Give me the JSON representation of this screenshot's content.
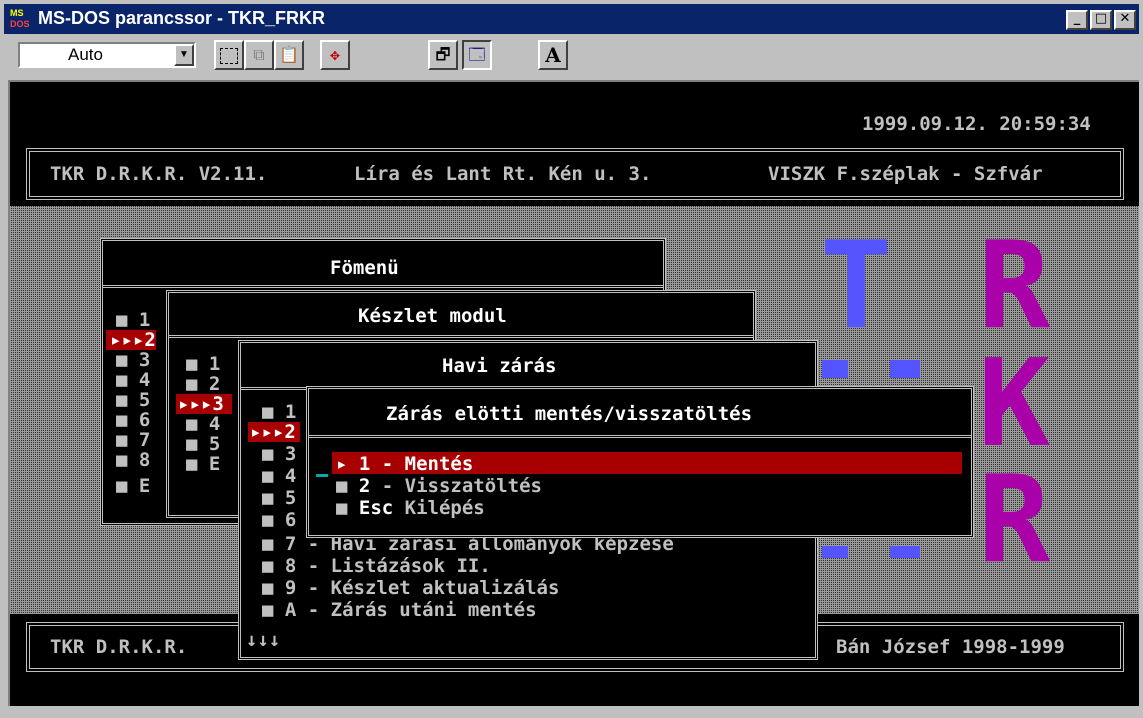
{
  "window": {
    "icon_text_top": "MS",
    "icon_text_bottom": "DOS",
    "title": "MS-DOS parancssor - TKR_FRKR",
    "minimize": "_",
    "maximize": "□",
    "close": "✕"
  },
  "toolbar": {
    "font_size_value": "Auto",
    "buttons": [
      "mark-icon",
      "copy-icon",
      "paste-icon",
      "fullscreen-icon",
      "properties-icon",
      "background-icon",
      "font-icon"
    ],
    "font_button_label": "A"
  },
  "console": {
    "timestamp": "1999.09.12. 20:59:34",
    "header_left": "TKR D.R.K.R. V2.11.",
    "header_mid": "Líra és Lant Rt. Kén u. 3.",
    "header_right": "VISZK F.széplak - Szfvár",
    "footer_left": "TKR D.R.K.R.",
    "footer_right": "Bán József 1998-1999",
    "logo_letters": [
      "T",
      "R",
      "R",
      "K",
      "R"
    ],
    "menus": {
      "fomenu": {
        "title": "Fömenü",
        "items": [
          "■ 1",
          "▸▸▸2",
          "■ 3",
          "■ 4",
          "■ 5",
          "■ 6",
          "■ 7",
          "■ 8",
          "■ E"
        ]
      },
      "keszlet": {
        "title": "Készlet modul",
        "items": [
          "■ 1",
          "■ 2",
          "▸▸▸3",
          "■ 4",
          "■ 5",
          "■ E"
        ]
      },
      "havi": {
        "title": "Havi zárás",
        "items": [
          "■ 1",
          "▸▸▸2",
          "■ 3",
          "■ 4",
          "■ 5",
          "■ 6"
        ],
        "long_items": [
          "■ 7 - Havi zárási állományok képzése",
          "■ 8 - Listázások II.",
          "■ 9 - Készlet aktualizálás",
          "■ A - Zárás utáni mentés"
        ],
        "more": "↓↓↓"
      },
      "mentes": {
        "title": "Zárás elötti mentés/visszatöltés",
        "items": [
          {
            "bullet": "▸",
            "key": "1",
            "label": " - Mentés"
          },
          {
            "bullet": "■",
            "key": "2",
            "label": " - Visszatöltés"
          },
          {
            "bullet": "■",
            "key": "Esc",
            "label": " Kilépés"
          }
        ]
      }
    }
  },
  "colors": {
    "selection": "#a80000",
    "logo_blue": "#5555ff",
    "logo_magenta": "#aa00aa"
  }
}
